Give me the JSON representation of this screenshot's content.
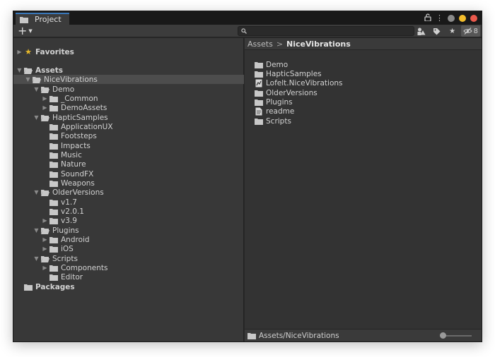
{
  "window": {
    "tab_label": "Project",
    "colors": {
      "close": "#e9594c",
      "minimize": "#f2bc2b",
      "maximize": "#8a8a8a",
      "accent": "#3a79bb"
    }
  },
  "toolbar": {
    "add_label": "+",
    "search_placeholder": "",
    "hidden_count": "8"
  },
  "tree": {
    "favorites": "Favorites",
    "assets": "Assets",
    "nice_vibrations": "NiceVibrations",
    "demo": "Demo",
    "common": "_Common",
    "demo_assets": "DemoAssets",
    "haptic_samples": "HapticSamples",
    "application_ux": "ApplicationUX",
    "footsteps": "Footsteps",
    "impacts": "Impacts",
    "music": "Music",
    "nature": "Nature",
    "soundfx": "SoundFX",
    "weapons": "Weapons",
    "older_versions": "OlderVersions",
    "v17": "v1.7",
    "v201": "v2.0.1",
    "v39": "v3.9",
    "plugins": "Plugins",
    "android": "Android",
    "ios": "iOS",
    "scripts": "Scripts",
    "components": "Components",
    "editor": "Editor",
    "packages": "Packages"
  },
  "breadcrumb": {
    "root": "Assets",
    "separator": ">",
    "current": "NiceVibrations"
  },
  "contents": {
    "demo": "Demo",
    "haptic_samples": "HapticSamples",
    "lofelt": "Lofelt.NiceVibrations",
    "older_versions": "OlderVersions",
    "plugins": "Plugins",
    "readme": "readme",
    "scripts": "Scripts"
  },
  "status": {
    "path": "Assets/NiceVibrations"
  }
}
